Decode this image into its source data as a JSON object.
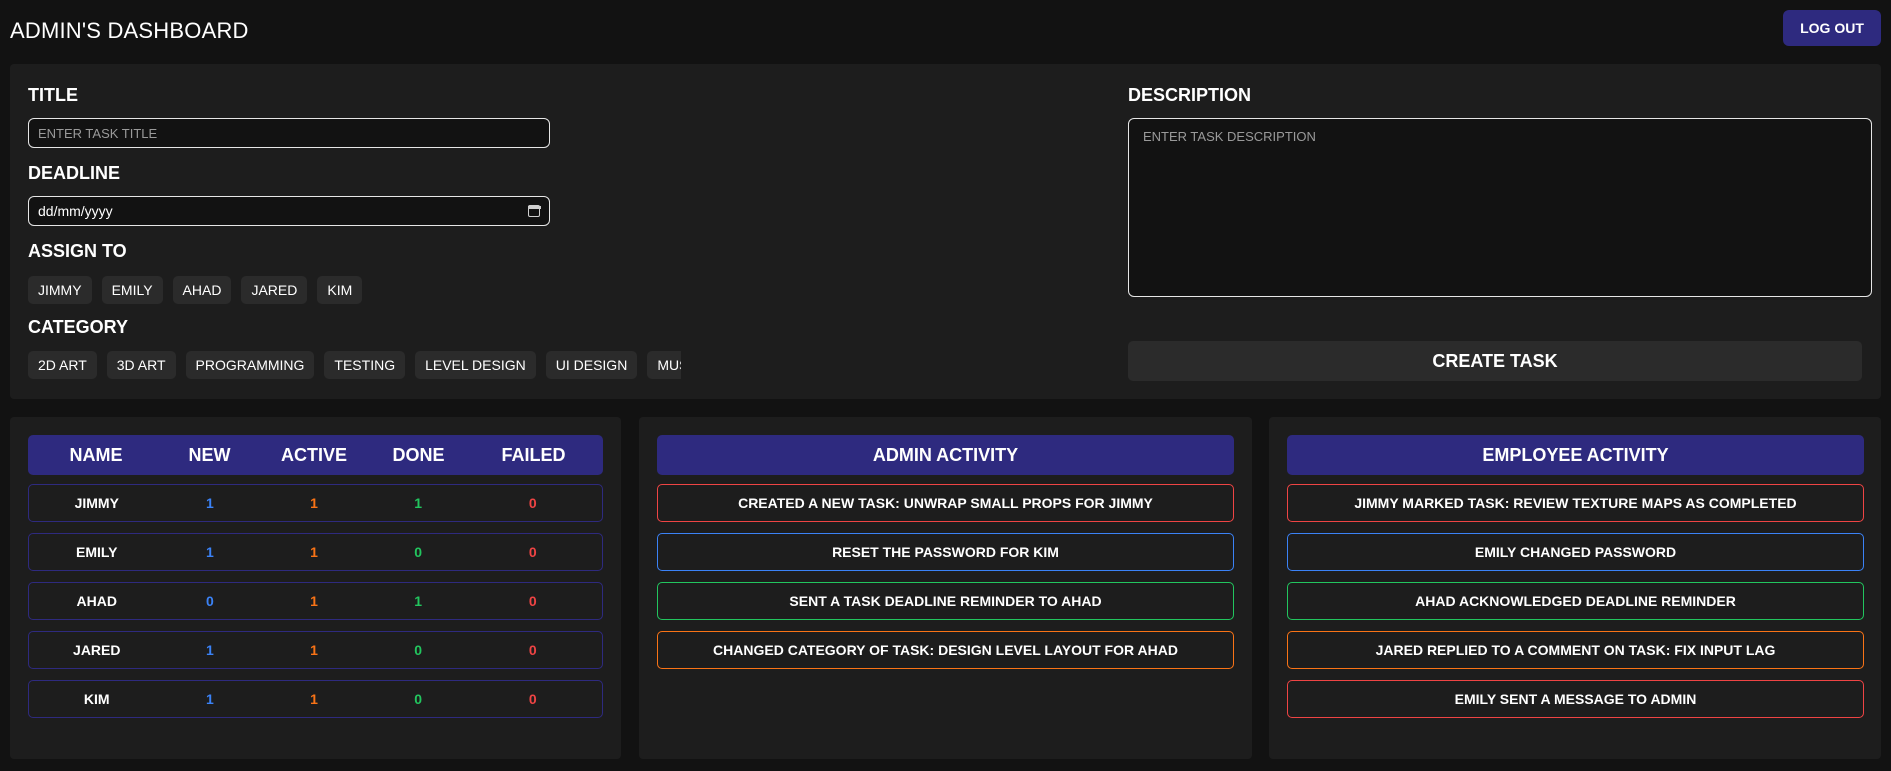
{
  "header": {
    "title": "ADMIN'S DASHBOARD",
    "logout_label": "LOG OUT"
  },
  "form": {
    "title_label": "TITLE",
    "title_placeholder": "ENTER TASK TITLE",
    "deadline_label": "DEADLINE",
    "deadline_value": "dd/mm/yyyy",
    "assign_label": "ASSIGN TO",
    "assignees": [
      "JIMMY",
      "EMILY",
      "AHAD",
      "JARED",
      "KIM"
    ],
    "category_label": "CATEGORY",
    "categories": [
      "2D ART",
      "3D ART",
      "PROGRAMMING",
      "TESTING",
      "LEVEL DESIGN",
      "UI DESIGN",
      "MUSIC"
    ],
    "description_label": "DESCRIPTION",
    "description_placeholder": "ENTER TASK DESCRIPTION",
    "create_label": "CREATE TASK"
  },
  "stats_table": {
    "headers": [
      "NAME",
      "NEW",
      "ACTIVE",
      "DONE",
      "FAILED"
    ],
    "rows": [
      [
        "JIMMY",
        "1",
        "1",
        "1",
        "0"
      ],
      [
        "EMILY",
        "1",
        "1",
        "0",
        "0"
      ],
      [
        "AHAD",
        "0",
        "1",
        "1",
        "0"
      ],
      [
        "JARED",
        "1",
        "1",
        "0",
        "0"
      ],
      [
        "KIM",
        "1",
        "1",
        "0",
        "0"
      ]
    ]
  },
  "admin_activity": {
    "title": "ADMIN ACTIVITY",
    "items": [
      "CREATED A NEW TASK: UNWRAP SMALL PROPS FOR JIMMY",
      "RESET THE PASSWORD FOR KIM",
      "SENT A TASK DEADLINE REMINDER TO AHAD",
      "CHANGED CATEGORY OF TASK: DESIGN LEVEL LAYOUT FOR AHAD"
    ]
  },
  "employee_activity": {
    "title": "EMPLOYEE ACTIVITY",
    "items": [
      "JIMMY MARKED TASK: REVIEW TEXTURE MAPS AS COMPLETED",
      "EMILY CHANGED PASSWORD",
      "AHAD ACKNOWLEDGED DEADLINE REMINDER",
      "JARED REPLIED TO A COMMENT ON TASK: FIX INPUT LAG",
      "EMILY SENT A MESSAGE TO ADMIN"
    ]
  },
  "colors": {
    "accent": "#2e2a7f",
    "new": "#3b82f6",
    "active": "#f97316",
    "done": "#22c55e",
    "failed": "#ef4444",
    "activity_borders": [
      "#ef4444",
      "#3b82f6",
      "#22c55e",
      "#f97316",
      "#ef4444"
    ]
  }
}
